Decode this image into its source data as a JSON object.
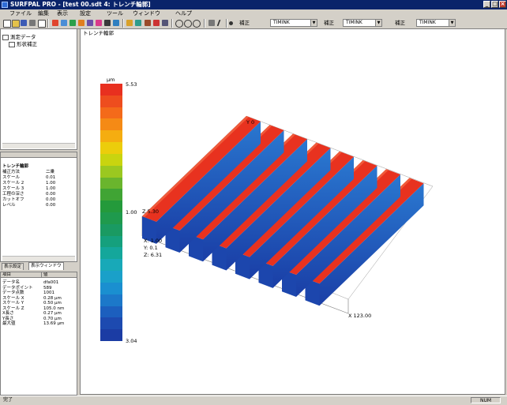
{
  "window": {
    "title": "SURFPAL PRO - [test 00.sdt 4: トレンチ輪郭]",
    "buttons": [
      "_",
      "□",
      "×"
    ]
  },
  "menu": [
    "ファイル",
    "編集",
    "表示",
    "設定",
    "ツール",
    "ウィンドウ",
    "ヘルプ"
  ],
  "toolbar": {
    "label1": "補正",
    "combo1": "TIMINK",
    "label2": "補正",
    "combo2": "TIMINK",
    "label3": "補正",
    "combo3": "TIMINK"
  },
  "tree": {
    "items": [
      "測定データ",
      "形状補正"
    ]
  },
  "properties": {
    "title": "トレンチ輪郭",
    "rows": [
      {
        "k": "補正方法",
        "v": "二乗"
      },
      {
        "k": "スケール",
        "v": "0.01"
      },
      {
        "k": "スケール 2",
        "v": "1.00"
      },
      {
        "k": "スケール 3",
        "v": "1.00"
      },
      {
        "k": "工程の深さ",
        "v": "0.00"
      },
      {
        "k": "カットオフ",
        "v": "0.00"
      },
      {
        "k": "レベル",
        "v": "0.00"
      }
    ]
  },
  "tabs": [
    "表示設定",
    "表示ウィンドウ"
  ],
  "table": {
    "headers": [
      "項目",
      "値"
    ],
    "rows": [
      {
        "k": "データ名",
        "v": "dfa001"
      },
      {
        "k": "データポイント",
        "v": "589"
      },
      {
        "k": "データ点数",
        "v": "1001"
      },
      {
        "k": "スケール X",
        "v": "0.28 μm"
      },
      {
        "k": "スケール Y",
        "v": "0.50 μm"
      },
      {
        "k": "スケール Z",
        "v": "105.0 nm"
      },
      {
        "k": "X長さ",
        "v": "0.27 μm"
      },
      {
        "k": "Y長さ",
        "v": "0.70 μm"
      },
      {
        "k": "最大値",
        "v": "13.69 μm"
      }
    ]
  },
  "view": {
    "title": "トレンチ輪郭",
    "legend_unit": "μm",
    "legend_max": "5.53",
    "legend_mid": "1.00",
    "legend_min": "3.04",
    "axis_z": "Z 5.30",
    "axis_y": "Y 0",
    "axis_x": "X 123.00",
    "cursor_x": "X: 1.00",
    "cursor_y": "Y: 0.1",
    "cursor_z": "Z: 6.31",
    "legend_colors": [
      "#e8301f",
      "#ee4d1e",
      "#f46a1a",
      "#f58a15",
      "#f5ad10",
      "#eccd0b",
      "#c9d40f",
      "#9bc820",
      "#6ab52d",
      "#40a434",
      "#249a3b",
      "#1f9a4d",
      "#1a9a62",
      "#15a07d",
      "#14a79b",
      "#18a9b8",
      "#1aa0c9",
      "#1a8fd0",
      "#1c78c9",
      "#1c5fbe",
      "#1d4ab0",
      "#1b3ca4"
    ]
  },
  "status": {
    "left": "完了",
    "right": "NUM"
  }
}
